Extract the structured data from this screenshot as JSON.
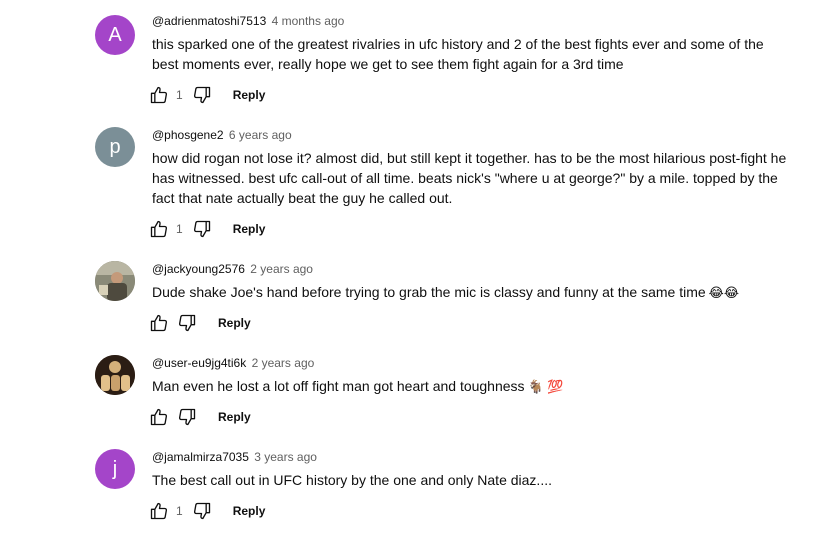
{
  "comments": [
    {
      "avatar_letter": "A",
      "avatar_color": "#a445c9",
      "author": "@adrienmatoshi7513",
      "time": "4 months ago",
      "text": "this sparked one of the greatest rivalries in ufc history and 2 of the best fights ever and some of the best moments ever, really hope we get to see them fight again for a 3rd time",
      "likes": "1",
      "reply_label": "Reply"
    },
    {
      "avatar_letter": "p",
      "avatar_color": "#7b8f97",
      "author": "@phosgene2",
      "time": "6 years ago",
      "text": "how did rogan not lose it? almost did, but still kept it together. has to be the most hilarious post-fight he has witnessed. best ufc call-out of all time. beats nick's \"where u at george?\" by a mile. topped by the fact that nate actually beat the guy he called out.",
      "likes": "1",
      "reply_label": "Reply"
    },
    {
      "avatar_letter": "",
      "avatar_color": "#6b6a55",
      "author": "@jackyoung2576",
      "time": "2 years ago",
      "text": "Dude shake Joe's hand before trying to grab the mic is classy and funny at the same time",
      "emoji": "😂😂",
      "likes": "",
      "reply_label": "Reply"
    },
    {
      "avatar_letter": "",
      "avatar_color": "#3a2a1e",
      "author": "@user-eu9jg4ti6k",
      "time": "2 years ago",
      "text": "Man even he lost a lot off fight man got heart and toughness",
      "emoji": "🐐 💯",
      "likes": "",
      "reply_label": "Reply"
    },
    {
      "avatar_letter": "j",
      "avatar_color": "#a445c9",
      "author": "@jamalmirza7035",
      "time": "3 years ago",
      "text": "The best call out in UFC history by the one and only Nate diaz....",
      "likes": "1",
      "reply_label": "Reply"
    }
  ],
  "icons": {
    "like": "thumbs-up-icon",
    "dislike": "thumbs-down-icon"
  }
}
